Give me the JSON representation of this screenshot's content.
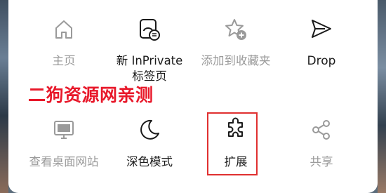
{
  "menu": {
    "row1": [
      {
        "id": "home",
        "label": "主页",
        "icon": "home-icon",
        "enabled": false
      },
      {
        "id": "new-inprivate",
        "label_line1": "新 InPrivate",
        "label_line2": "标签页",
        "icon": "inprivate-tab-icon",
        "enabled": true
      },
      {
        "id": "add-favorites",
        "label": "添加到收藏夹",
        "icon": "star-add-icon",
        "enabled": false
      },
      {
        "id": "drop",
        "label": "Drop",
        "icon": "send-icon",
        "enabled": true
      }
    ],
    "row2": [
      {
        "id": "desktop-site",
        "label": "查看桌面网站",
        "icon": "monitor-icon",
        "enabled": false
      },
      {
        "id": "dark-mode",
        "label": "深色模式",
        "icon": "moon-icon",
        "enabled": true
      },
      {
        "id": "extensions",
        "label": "扩展",
        "icon": "puzzle-icon",
        "enabled": true,
        "highlighted": true
      },
      {
        "id": "share",
        "label": "共享",
        "icon": "share-icon",
        "enabled": false
      }
    ]
  },
  "watermark": {
    "text": "二狗资源网亲测",
    "color": "#e8182a"
  },
  "colors": {
    "enabled": "#1a1a1a",
    "disabled": "#9a9a9a",
    "highlight_border": "#e03030"
  }
}
